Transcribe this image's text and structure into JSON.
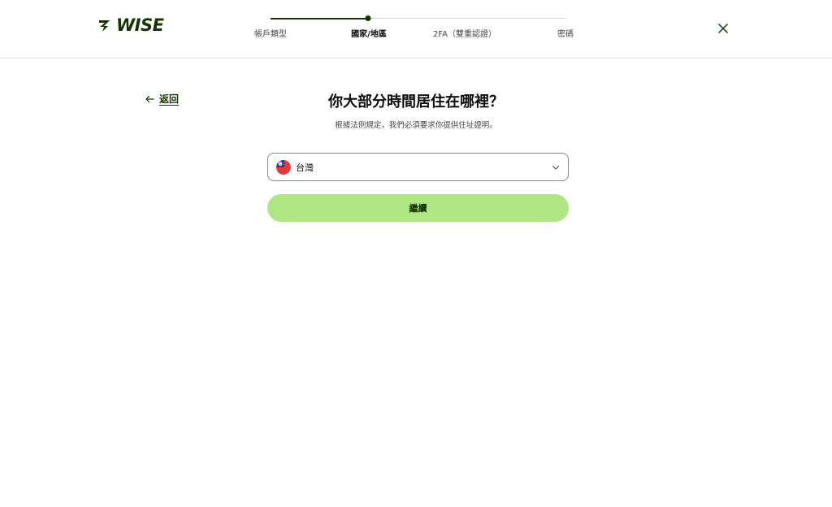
{
  "brand": {
    "name": "WISE",
    "color": "#163300",
    "accent": "#9fe870"
  },
  "header": {
    "steps": [
      {
        "label": "帳戶類型",
        "state": "done"
      },
      {
        "label": "國家/地區",
        "state": "current"
      },
      {
        "label": "2FA（雙重認證）",
        "state": "upcoming"
      },
      {
        "label": "密碼",
        "state": "upcoming"
      }
    ],
    "progress_fraction": 0.33,
    "close_icon": "close-icon"
  },
  "nav": {
    "back_label": "返回",
    "back_icon": "arrow-left-icon"
  },
  "main": {
    "title": "你大部分時間居住在哪裡？",
    "subtitle": "根據法例規定，我們必須要求你提供住址證明。",
    "country_select": {
      "value": "台灣",
      "flag_icon": "taiwan-flag-icon",
      "chevron_icon": "chevron-down-icon"
    },
    "continue_label": "繼續",
    "continue_color": "#aee683"
  }
}
